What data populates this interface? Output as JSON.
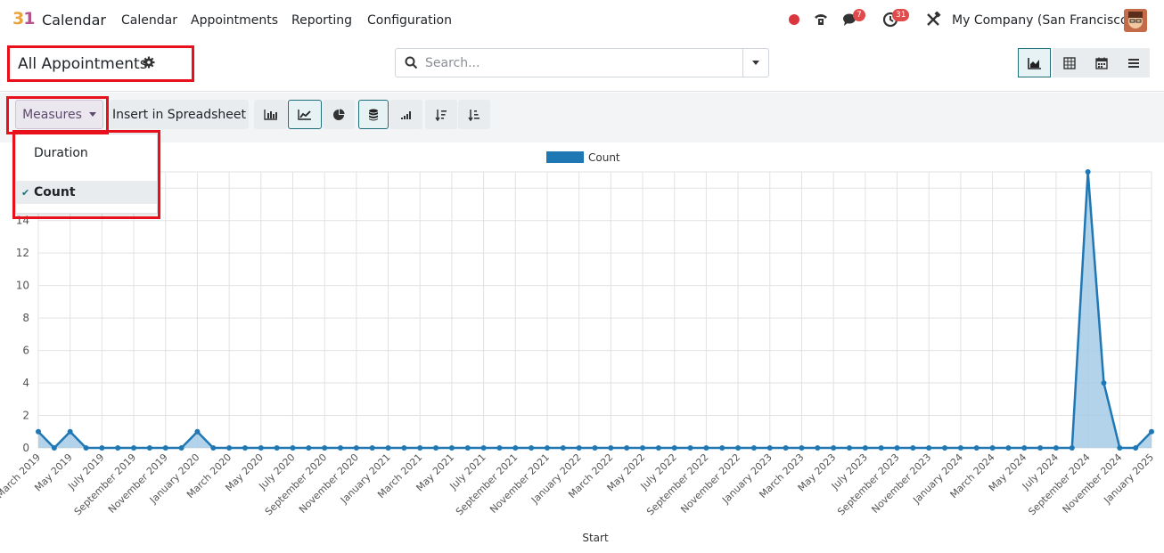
{
  "app": {
    "logo_text": "31",
    "name": "Calendar"
  },
  "menu": [
    "Calendar",
    "Appointments",
    "Reporting",
    "Configuration"
  ],
  "systray": {
    "messages_badge": "7",
    "activities_badge": "31",
    "company": "My Company (San Francisco)"
  },
  "control_panel": {
    "title": "All Appointments",
    "search_placeholder": "Search..."
  },
  "toolbar": {
    "measures_label": "Measures",
    "insert_label": "Insert in Spreadsheet"
  },
  "measures_menu": {
    "items": [
      "Duration",
      "Count"
    ],
    "checked": "Count"
  },
  "colors": {
    "accent": "#1f77b4",
    "fill": "#a6cbe6",
    "highlight": "#e8101a",
    "brand_teal": "#1f6f7a"
  },
  "chart_data": {
    "type": "area",
    "xlabel": "Start",
    "ylabel": "",
    "ylim": [
      0,
      17
    ],
    "yticks": [
      0,
      2,
      4,
      6,
      8,
      10,
      12,
      14
    ],
    "legend": {
      "position": "top",
      "entries": [
        "Count"
      ]
    },
    "grid": true,
    "x": [
      "March 2019",
      "April 2019",
      "May 2019",
      "June 2019",
      "July 2019",
      "August 2019",
      "September 2019",
      "October 2019",
      "November 2019",
      "December 2019",
      "January 2020",
      "February 2020",
      "March 2020",
      "April 2020",
      "May 2020",
      "June 2020",
      "July 2020",
      "August 2020",
      "September 2020",
      "October 2020",
      "November 2020",
      "December 2020",
      "January 2021",
      "February 2021",
      "March 2021",
      "April 2021",
      "May 2021",
      "June 2021",
      "July 2021",
      "August 2021",
      "September 2021",
      "October 2021",
      "November 2021",
      "December 2021",
      "January 2022",
      "February 2022",
      "March 2022",
      "April 2022",
      "May 2022",
      "June 2022",
      "July 2022",
      "August 2022",
      "September 2022",
      "October 2022",
      "November 2022",
      "December 2022",
      "January 2023",
      "February 2023",
      "March 2023",
      "April 2023",
      "May 2023",
      "June 2023",
      "July 2023",
      "August 2023",
      "September 2023",
      "October 2023",
      "November 2023",
      "December 2023",
      "January 2024",
      "February 2024",
      "March 2024",
      "April 2024",
      "May 2024",
      "June 2024",
      "July 2024",
      "August 2024",
      "September 2024",
      "October 2024",
      "November 2024",
      "December 2024",
      "January 2025"
    ],
    "tick_labels": [
      "March 2019",
      "May 2019",
      "July 2019",
      "September 2019",
      "November 2019",
      "January 2020",
      "March 2020",
      "May 2020",
      "July 2020",
      "September 2020",
      "November 2020",
      "January 2021",
      "March 2021",
      "May 2021",
      "July 2021",
      "September 2021",
      "November 2021",
      "January 2022",
      "March 2022",
      "May 2022",
      "July 2022",
      "September 2022",
      "November 2022",
      "January 2023",
      "March 2023",
      "May 2023",
      "July 2023",
      "September 2023",
      "November 2023",
      "January 2024",
      "March 2024",
      "May 2024",
      "July 2024",
      "September 2024",
      "November 2024",
      "January 2025"
    ],
    "series": [
      {
        "name": "Count",
        "values": [
          1,
          0,
          1,
          0,
          0,
          0,
          0,
          0,
          0,
          0,
          1,
          0,
          0,
          0,
          0,
          0,
          0,
          0,
          0,
          0,
          0,
          0,
          0,
          0,
          0,
          0,
          0,
          0,
          0,
          0,
          0,
          0,
          0,
          0,
          0,
          0,
          0,
          0,
          0,
          0,
          0,
          0,
          0,
          0,
          0,
          0,
          0,
          0,
          0,
          0,
          0,
          0,
          0,
          0,
          0,
          0,
          0,
          0,
          0,
          0,
          0,
          0,
          0,
          0,
          0,
          0,
          17,
          4,
          0,
          0,
          1
        ]
      }
    ]
  }
}
